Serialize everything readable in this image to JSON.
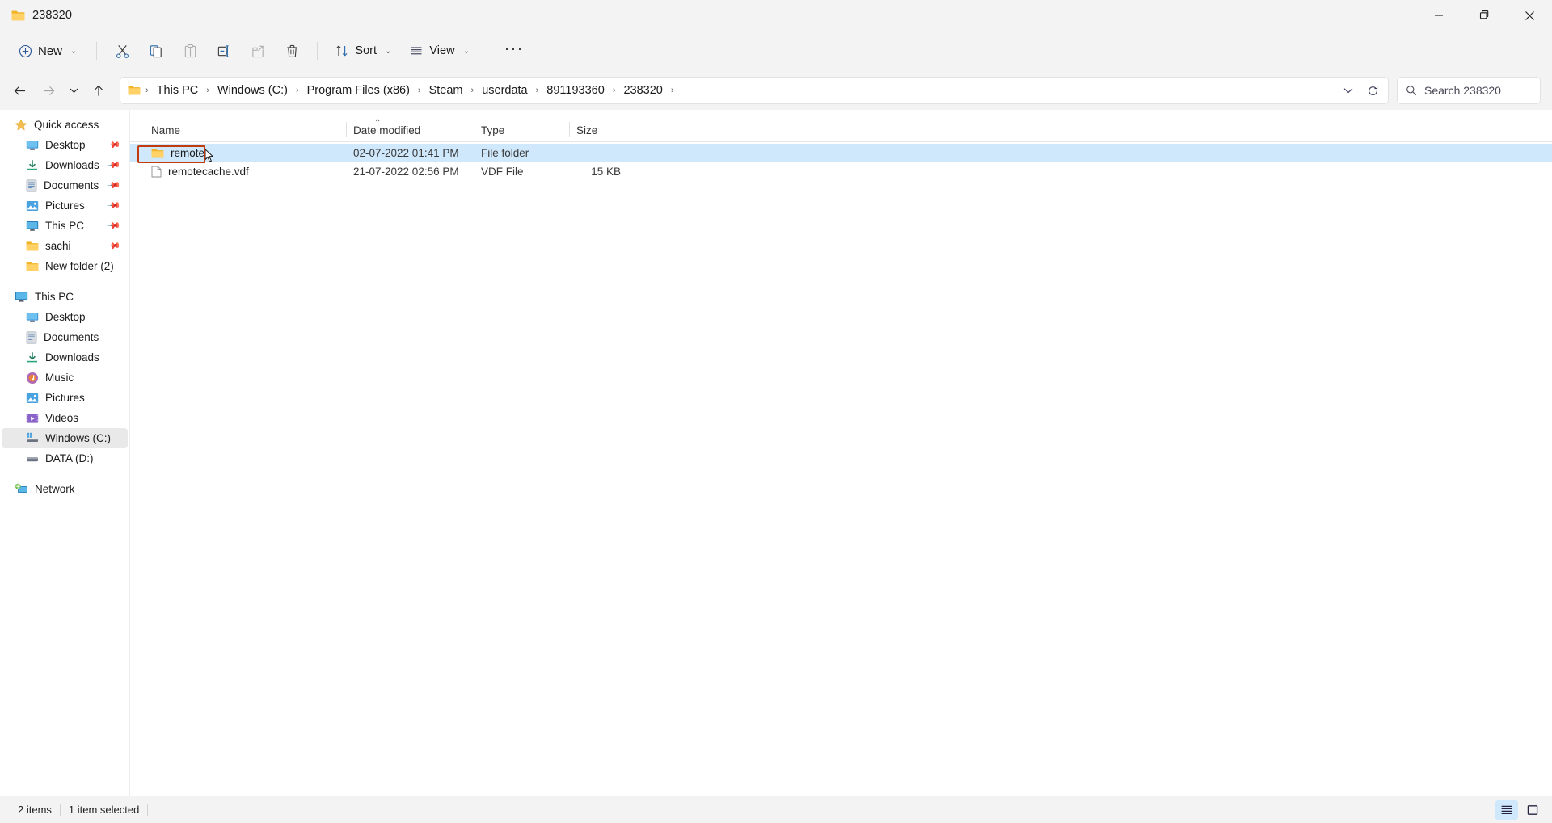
{
  "window": {
    "title": "238320",
    "title_icon": "folder-icon",
    "controls": {
      "minimize": "–",
      "maximize": "❐",
      "close": "✕"
    }
  },
  "toolbar": {
    "new_label": "New",
    "new_icon": "plus-circle-icon",
    "items": [
      {
        "name": "cut",
        "icon": "scissors-icon",
        "label": "",
        "disabled": false
      },
      {
        "name": "copy",
        "icon": "copy-icon",
        "label": "",
        "disabled": false
      },
      {
        "name": "paste",
        "icon": "paste-icon",
        "label": "",
        "disabled": true
      },
      {
        "name": "rename",
        "icon": "rename-icon",
        "label": "",
        "disabled": false
      },
      {
        "name": "share",
        "icon": "share-icon",
        "label": "",
        "disabled": true
      },
      {
        "name": "delete",
        "icon": "trash-icon",
        "label": "",
        "disabled": false
      }
    ],
    "sort_label": "Sort",
    "sort_icon": "sort-arrows-icon",
    "view_label": "View",
    "view_icon": "view-lines-icon",
    "more_label": "···"
  },
  "addressbar": {
    "back_icon": "arrow-left-icon",
    "forward_icon": "arrow-right-icon",
    "recent_icon": "chevron-down-icon",
    "up_icon": "arrow-up-icon",
    "path_icon": "folder-icon",
    "breadcrumbs": [
      "This PC",
      "Windows (C:)",
      "Program Files (x86)",
      "Steam",
      "userdata",
      "891193360",
      "238320"
    ],
    "separator": "›",
    "dropdown_icon": "chevron-down-icon",
    "refresh_icon": "refresh-icon"
  },
  "search": {
    "icon": "search-icon",
    "placeholder": "Search 238320"
  },
  "sidebar": {
    "groups": [
      {
        "header": {
          "label": "Quick access",
          "icon": "star-icon"
        },
        "items": [
          {
            "label": "Desktop",
            "icon": "desktop-icon",
            "pinned": true
          },
          {
            "label": "Downloads",
            "icon": "download-icon",
            "pinned": true
          },
          {
            "label": "Documents",
            "icon": "document-icon",
            "pinned": true
          },
          {
            "label": "Pictures",
            "icon": "pictures-icon",
            "pinned": true
          },
          {
            "label": "This PC",
            "icon": "pc-icon",
            "pinned": true
          },
          {
            "label": "sachi",
            "icon": "folder-icon",
            "pinned": true
          },
          {
            "label": "New folder (2)",
            "icon": "folder-icon",
            "pinned": false
          }
        ]
      },
      {
        "header": {
          "label": "This PC",
          "icon": "pc-icon"
        },
        "items": [
          {
            "label": "Desktop",
            "icon": "desktop-icon",
            "pinned": false,
            "selected": false
          },
          {
            "label": "Documents",
            "icon": "document-icon",
            "pinned": false,
            "selected": false
          },
          {
            "label": "Downloads",
            "icon": "download-icon",
            "pinned": false,
            "selected": false
          },
          {
            "label": "Music",
            "icon": "music-icon",
            "pinned": false,
            "selected": false
          },
          {
            "label": "Pictures",
            "icon": "pictures-icon",
            "pinned": false,
            "selected": false
          },
          {
            "label": "Videos",
            "icon": "video-icon",
            "pinned": false,
            "selected": false
          },
          {
            "label": "Windows (C:)",
            "icon": "drive-os-icon",
            "pinned": false,
            "selected": true
          },
          {
            "label": "DATA (D:)",
            "icon": "drive-icon",
            "pinned": false,
            "selected": false
          }
        ]
      },
      {
        "header": {
          "label": "Network",
          "icon": "network-icon"
        },
        "items": []
      }
    ]
  },
  "filelist": {
    "columns": [
      "Name",
      "Date modified",
      "Type",
      "Size"
    ],
    "sort_column": "Name",
    "sort_direction": "ascending",
    "rows": [
      {
        "name": "remote",
        "icon": "folder-icon",
        "date": "02-07-2022 01:41 PM",
        "type": "File folder",
        "size": "",
        "selected": true,
        "annotated": true
      },
      {
        "name": "remotecache.vdf",
        "icon": "file-icon",
        "date": "21-07-2022 02:56 PM",
        "type": "VDF File",
        "size": "15 KB",
        "selected": false,
        "annotated": false
      }
    ]
  },
  "statusbar": {
    "item_count": "2 items",
    "selection": "1 item selected",
    "view_buttons": [
      {
        "name": "details-view",
        "icon": "details-view-icon",
        "active": true
      },
      {
        "name": "large-icons-view",
        "icon": "large-icons-view-icon",
        "active": false
      }
    ]
  },
  "colors": {
    "selection_blue": "#cfe8fb",
    "annotation_red": "#c23b0e",
    "chrome_gray": "#f3f3f3",
    "accent_folder": "#f5bf4f"
  }
}
